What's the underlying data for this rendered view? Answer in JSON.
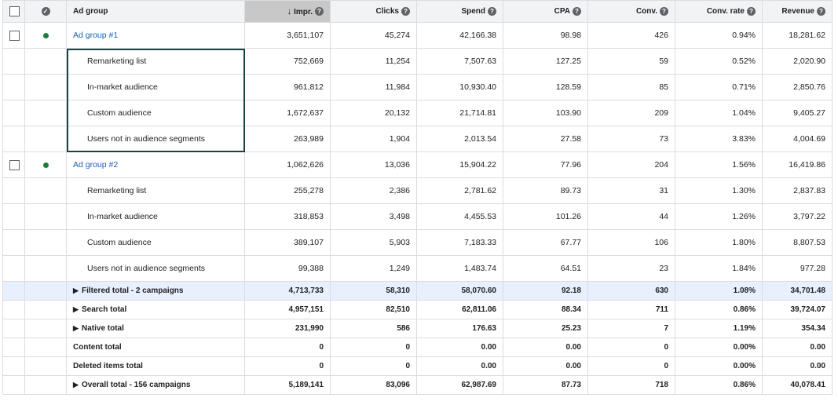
{
  "header": {
    "ad_group": "Ad group",
    "impr": "Impr.",
    "clicks": "Clicks",
    "spend": "Spend",
    "cpa": "CPA",
    "conv": "Conv.",
    "conv_rate": "Conv. rate",
    "revenue": "Revenue",
    "help_glyph": "?",
    "sort_glyph": "↓",
    "sorted_column": "impr"
  },
  "groups": [
    {
      "name": "Ad group #1",
      "status_color": "#188038",
      "impr": "3,651,107",
      "clicks": "45,274",
      "spend": "42,166.38",
      "cpa": "98.98",
      "conv": "426",
      "conv_rate": "0.94%",
      "revenue": "18,281.62",
      "segments": [
        {
          "name": "Remarketing list",
          "impr": "752,669",
          "clicks": "11,254",
          "spend": "7,507.63",
          "cpa": "127.25",
          "conv": "59",
          "conv_rate": "0.52%",
          "revenue": "2,020.90"
        },
        {
          "name": "In-market audience",
          "impr": "961,812",
          "clicks": "11,984",
          "spend": "10,930.40",
          "cpa": "128.59",
          "conv": "85",
          "conv_rate": "0.71%",
          "revenue": "2,850.76"
        },
        {
          "name": "Custom audience",
          "impr": "1,672,637",
          "clicks": "20,132",
          "spend": "21,714.81",
          "cpa": "103.90",
          "conv": "209",
          "conv_rate": "1.04%",
          "revenue": "9,405.27"
        },
        {
          "name": "Users not in audience segments",
          "impr": "263,989",
          "clicks": "1,904",
          "spend": "2,013.54",
          "cpa": "27.58",
          "conv": "73",
          "conv_rate": "3.83%",
          "revenue": "4,004.69"
        }
      ]
    },
    {
      "name": "Ad group #2",
      "status_color": "#188038",
      "impr": "1,062,626",
      "clicks": "13,036",
      "spend": "15,904.22",
      "cpa": "77.96",
      "conv": "204",
      "conv_rate": "1.56%",
      "revenue": "16,419.86",
      "segments": [
        {
          "name": "Remarketing list",
          "impr": "255,278",
          "clicks": "2,386",
          "spend": "2,781.62",
          "cpa": "89.73",
          "conv": "31",
          "conv_rate": "1.30%",
          "revenue": "2,837.83"
        },
        {
          "name": "In-market audience",
          "impr": "318,853",
          "clicks": "3,498",
          "spend": "4,455.53",
          "cpa": "101.26",
          "conv": "44",
          "conv_rate": "1.26%",
          "revenue": "3,797.22"
        },
        {
          "name": "Custom audience",
          "impr": "389,107",
          "clicks": "5,903",
          "spend": "7,183.33",
          "cpa": "67.77",
          "conv": "106",
          "conv_rate": "1.80%",
          "revenue": "8,807.53"
        },
        {
          "name": "Users not in audience segments",
          "impr": "99,388",
          "clicks": "1,249",
          "spend": "1,483.74",
          "cpa": "64.51",
          "conv": "23",
          "conv_rate": "1.84%",
          "revenue": "977.28"
        }
      ]
    }
  ],
  "totals": [
    {
      "name": "Filtered total - 2 campaigns",
      "expandable": true,
      "highlight": true,
      "impr": "4,713,733",
      "clicks": "58,310",
      "spend": "58,070.60",
      "cpa": "92.18",
      "conv": "630",
      "conv_rate": "1.08%",
      "revenue": "34,701.48"
    },
    {
      "name": "Search total",
      "expandable": true,
      "highlight": false,
      "impr": "4,957,151",
      "clicks": "82,510",
      "spend": "62,811.06",
      "cpa": "88.34",
      "conv": "711",
      "conv_rate": "0.86%",
      "revenue": "39,724.07"
    },
    {
      "name": "Native total",
      "expandable": true,
      "highlight": false,
      "impr": "231,990",
      "clicks": "586",
      "spend": "176.63",
      "cpa": "25.23",
      "conv": "7",
      "conv_rate": "1.19%",
      "revenue": "354.34"
    },
    {
      "name": "Content total",
      "expandable": false,
      "highlight": false,
      "impr": "0",
      "clicks": "0",
      "spend": "0.00",
      "cpa": "0.00",
      "conv": "0",
      "conv_rate": "0.00%",
      "revenue": "0.00"
    },
    {
      "name": "Deleted items total",
      "expandable": false,
      "highlight": false,
      "impr": "0",
      "clicks": "0",
      "spend": "0.00",
      "cpa": "0.00",
      "conv": "0",
      "conv_rate": "0.00%",
      "revenue": "0.00"
    },
    {
      "name": "Overall total - 156 campaigns",
      "expandable": true,
      "highlight": false,
      "impr": "5,189,141",
      "clicks": "83,096",
      "spend": "62,987.69",
      "cpa": "87.73",
      "conv": "718",
      "conv_rate": "0.86%",
      "revenue": "40,078.41"
    }
  ],
  "icons": {
    "checkbox": "checkbox-icon",
    "status": "status-check-icon",
    "help": "help-icon",
    "sort": "sort-down-arrow-icon",
    "expand": "expand-triangle-icon",
    "enabled_dot": "enabled-dot-icon"
  },
  "colors": {
    "header_bg": "#f1f3f4",
    "sorted_header_bg": "#c8c8c8",
    "filtered_total_bg": "#e8f0fe",
    "link": "#1a5fb4",
    "enabled": "#188038",
    "highlight_box": "#1b4444"
  }
}
